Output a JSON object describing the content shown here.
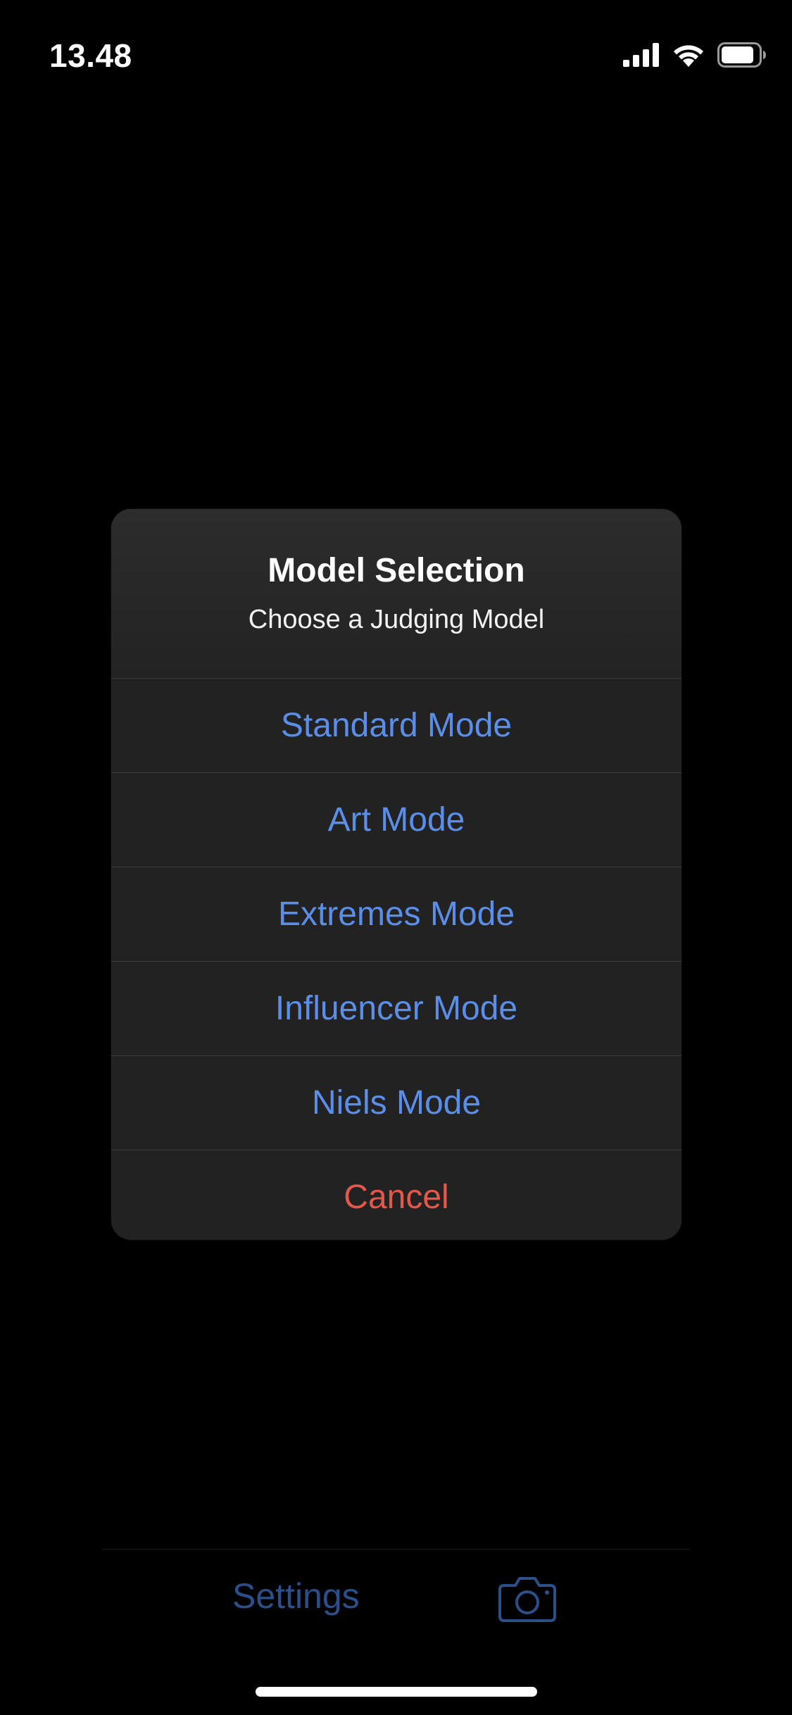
{
  "status_bar": {
    "time": "13.48",
    "icons": [
      "cellular-signal-icon",
      "wifi-icon",
      "battery-icon"
    ]
  },
  "alert": {
    "title": "Model Selection",
    "message": "Choose a Judging Model",
    "actions": [
      {
        "label": "Standard Mode",
        "style": "default"
      },
      {
        "label": "Art Mode",
        "style": "default"
      },
      {
        "label": "Extremes Mode",
        "style": "default"
      },
      {
        "label": "Influencer Mode",
        "style": "default"
      },
      {
        "label": "Niels Mode",
        "style": "default"
      },
      {
        "label": "Cancel",
        "style": "cancel"
      }
    ]
  },
  "tab_bar": {
    "settings_label": "Settings",
    "camera_icon": "camera-icon"
  },
  "colors": {
    "background": "#000000",
    "alert_background": "#222222",
    "action_blue": "#5a8ee8",
    "cancel_red": "#e5574a",
    "dimmed_tab_blue": "#2c4f8a"
  }
}
